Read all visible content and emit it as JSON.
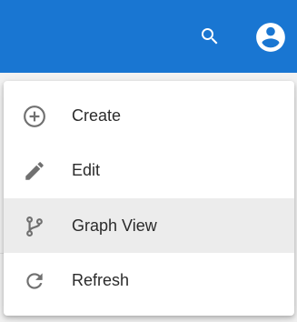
{
  "header": {
    "search_icon": "search-icon",
    "account_icon": "account-circle-icon",
    "brand_color": "#1976d2"
  },
  "menu": {
    "selected_item": "Graph View",
    "items": [
      {
        "label": "Create",
        "icon": "add-circle-outline-icon"
      },
      {
        "label": "Edit",
        "icon": "pencil-icon"
      },
      {
        "label": "Graph View",
        "icon": "branch-icon"
      },
      {
        "label": "Refresh",
        "icon": "refresh-icon"
      }
    ]
  }
}
